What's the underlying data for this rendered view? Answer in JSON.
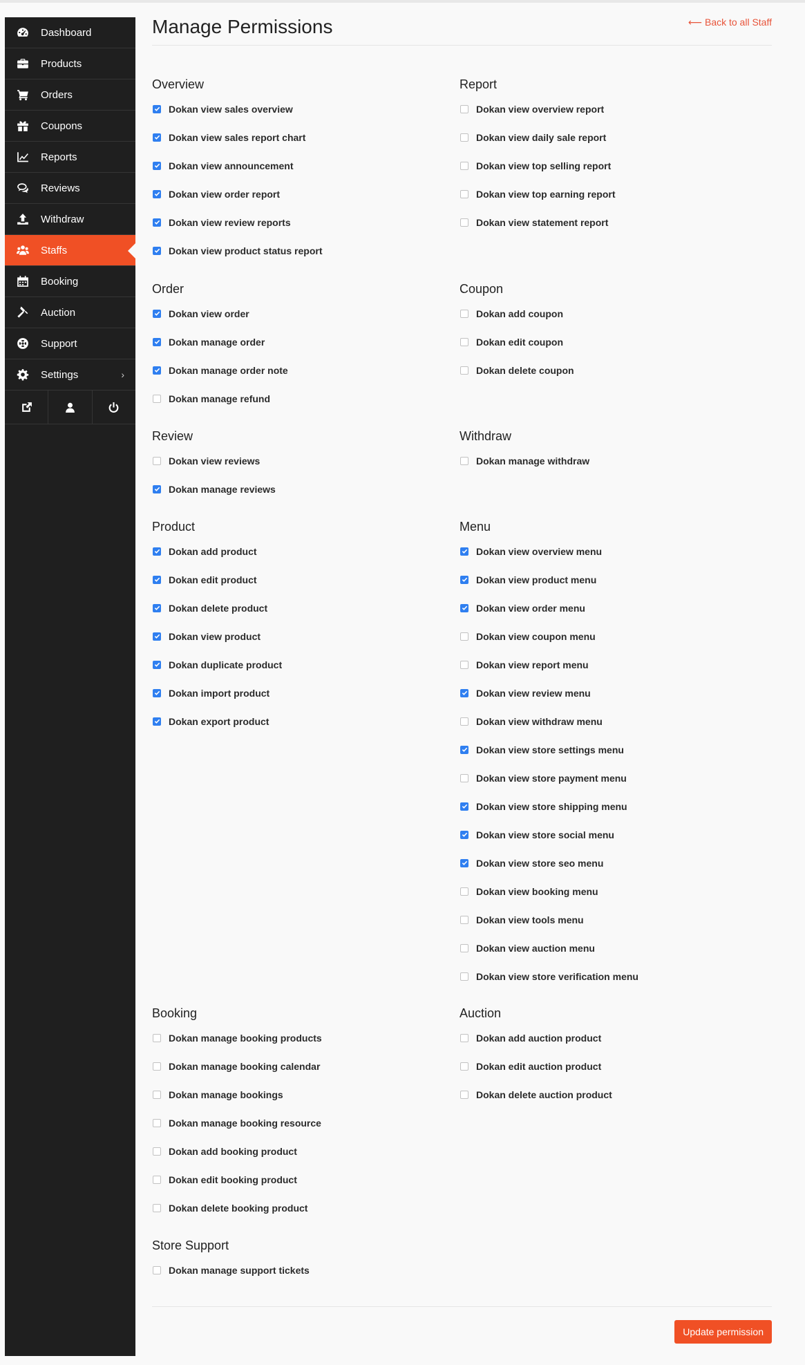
{
  "sidebar": {
    "items": [
      {
        "label": "Dashboard",
        "icon": "dashboard-icon"
      },
      {
        "label": "Products",
        "icon": "briefcase-icon"
      },
      {
        "label": "Orders",
        "icon": "cart-icon"
      },
      {
        "label": "Coupons",
        "icon": "gift-icon"
      },
      {
        "label": "Reports",
        "icon": "line-chart-icon"
      },
      {
        "label": "Reviews",
        "icon": "comments-icon"
      },
      {
        "label": "Withdraw",
        "icon": "upload-icon"
      },
      {
        "label": "Staffs",
        "icon": "users-icon",
        "active": true
      },
      {
        "label": "Booking",
        "icon": "calendar-icon"
      },
      {
        "label": "Auction",
        "icon": "gavel-icon"
      },
      {
        "label": "Support",
        "icon": "life-ring-icon"
      },
      {
        "label": "Settings",
        "icon": "gear-icon",
        "chevron": "›"
      }
    ],
    "bottom_icons": [
      "external-link-icon",
      "user-icon",
      "power-icon"
    ]
  },
  "header": {
    "title": "Manage Permissions",
    "back_link": "⟵ Back to all Staff"
  },
  "accent_color": "#f05025",
  "checkbox_color": "#2f7ff0",
  "sections": {
    "overview": {
      "title": "Overview",
      "items": [
        {
          "label": "Dokan view sales overview",
          "checked": true
        },
        {
          "label": "Dokan view sales report chart",
          "checked": true
        },
        {
          "label": "Dokan view announcement",
          "checked": true
        },
        {
          "label": "Dokan view order report",
          "checked": true
        },
        {
          "label": "Dokan view review reports",
          "checked": true
        },
        {
          "label": "Dokan view product status report",
          "checked": true
        }
      ]
    },
    "report": {
      "title": "Report",
      "items": [
        {
          "label": "Dokan view overview report",
          "checked": false
        },
        {
          "label": "Dokan view daily sale report",
          "checked": false
        },
        {
          "label": "Dokan view top selling report",
          "checked": false
        },
        {
          "label": "Dokan view top earning report",
          "checked": false
        },
        {
          "label": "Dokan view statement report",
          "checked": false
        }
      ]
    },
    "order": {
      "title": "Order",
      "items": [
        {
          "label": "Dokan view order",
          "checked": true
        },
        {
          "label": "Dokan manage order",
          "checked": true
        },
        {
          "label": "Dokan manage order note",
          "checked": true
        },
        {
          "label": "Dokan manage refund",
          "checked": false
        }
      ]
    },
    "coupon": {
      "title": "Coupon",
      "items": [
        {
          "label": "Dokan add coupon",
          "checked": false
        },
        {
          "label": "Dokan edit coupon",
          "checked": false
        },
        {
          "label": "Dokan delete coupon",
          "checked": false
        }
      ]
    },
    "review": {
      "title": "Review",
      "items": [
        {
          "label": "Dokan view reviews",
          "checked": false
        },
        {
          "label": "Dokan manage reviews",
          "checked": true
        }
      ]
    },
    "withdraw": {
      "title": "Withdraw",
      "items": [
        {
          "label": "Dokan manage withdraw",
          "checked": false
        }
      ]
    },
    "product": {
      "title": "Product",
      "items": [
        {
          "label": "Dokan add product",
          "checked": true
        },
        {
          "label": "Dokan edit product",
          "checked": true
        },
        {
          "label": "Dokan delete product",
          "checked": true
        },
        {
          "label": "Dokan view product",
          "checked": true
        },
        {
          "label": "Dokan duplicate product",
          "checked": true
        },
        {
          "label": "Dokan import product",
          "checked": true
        },
        {
          "label": "Dokan export product",
          "checked": true
        }
      ]
    },
    "menu": {
      "title": "Menu",
      "items": [
        {
          "label": "Dokan view overview menu",
          "checked": true
        },
        {
          "label": "Dokan view product menu",
          "checked": true
        },
        {
          "label": "Dokan view order menu",
          "checked": true
        },
        {
          "label": "Dokan view coupon menu",
          "checked": false
        },
        {
          "label": "Dokan view report menu",
          "checked": false
        },
        {
          "label": "Dokan view review menu",
          "checked": true
        },
        {
          "label": "Dokan view withdraw menu",
          "checked": false
        },
        {
          "label": "Dokan view store settings menu",
          "checked": true
        },
        {
          "label": "Dokan view store payment menu",
          "checked": false
        },
        {
          "label": "Dokan view store shipping menu",
          "checked": true
        },
        {
          "label": "Dokan view store social menu",
          "checked": true
        },
        {
          "label": "Dokan view store seo menu",
          "checked": true
        },
        {
          "label": "Dokan view booking menu",
          "checked": false
        },
        {
          "label": "Dokan view tools menu",
          "checked": false
        },
        {
          "label": "Dokan view auction menu",
          "checked": false
        },
        {
          "label": "Dokan view store verification menu",
          "checked": false
        }
      ]
    },
    "booking": {
      "title": "Booking",
      "items": [
        {
          "label": "Dokan manage booking products",
          "checked": false
        },
        {
          "label": "Dokan manage booking calendar",
          "checked": false
        },
        {
          "label": "Dokan manage bookings",
          "checked": false
        },
        {
          "label": "Dokan manage booking resource",
          "checked": false
        },
        {
          "label": "Dokan add booking product",
          "checked": false
        },
        {
          "label": "Dokan edit booking product",
          "checked": false
        },
        {
          "label": "Dokan delete booking product",
          "checked": false
        }
      ]
    },
    "auction": {
      "title": "Auction",
      "items": [
        {
          "label": "Dokan add auction product",
          "checked": false
        },
        {
          "label": "Dokan edit auction product",
          "checked": false
        },
        {
          "label": "Dokan delete auction product",
          "checked": false
        }
      ]
    },
    "store_support": {
      "title": "Store Support",
      "items": [
        {
          "label": "Dokan manage support tickets",
          "checked": false
        }
      ]
    }
  },
  "footer": {
    "update_label": "Update permission"
  }
}
